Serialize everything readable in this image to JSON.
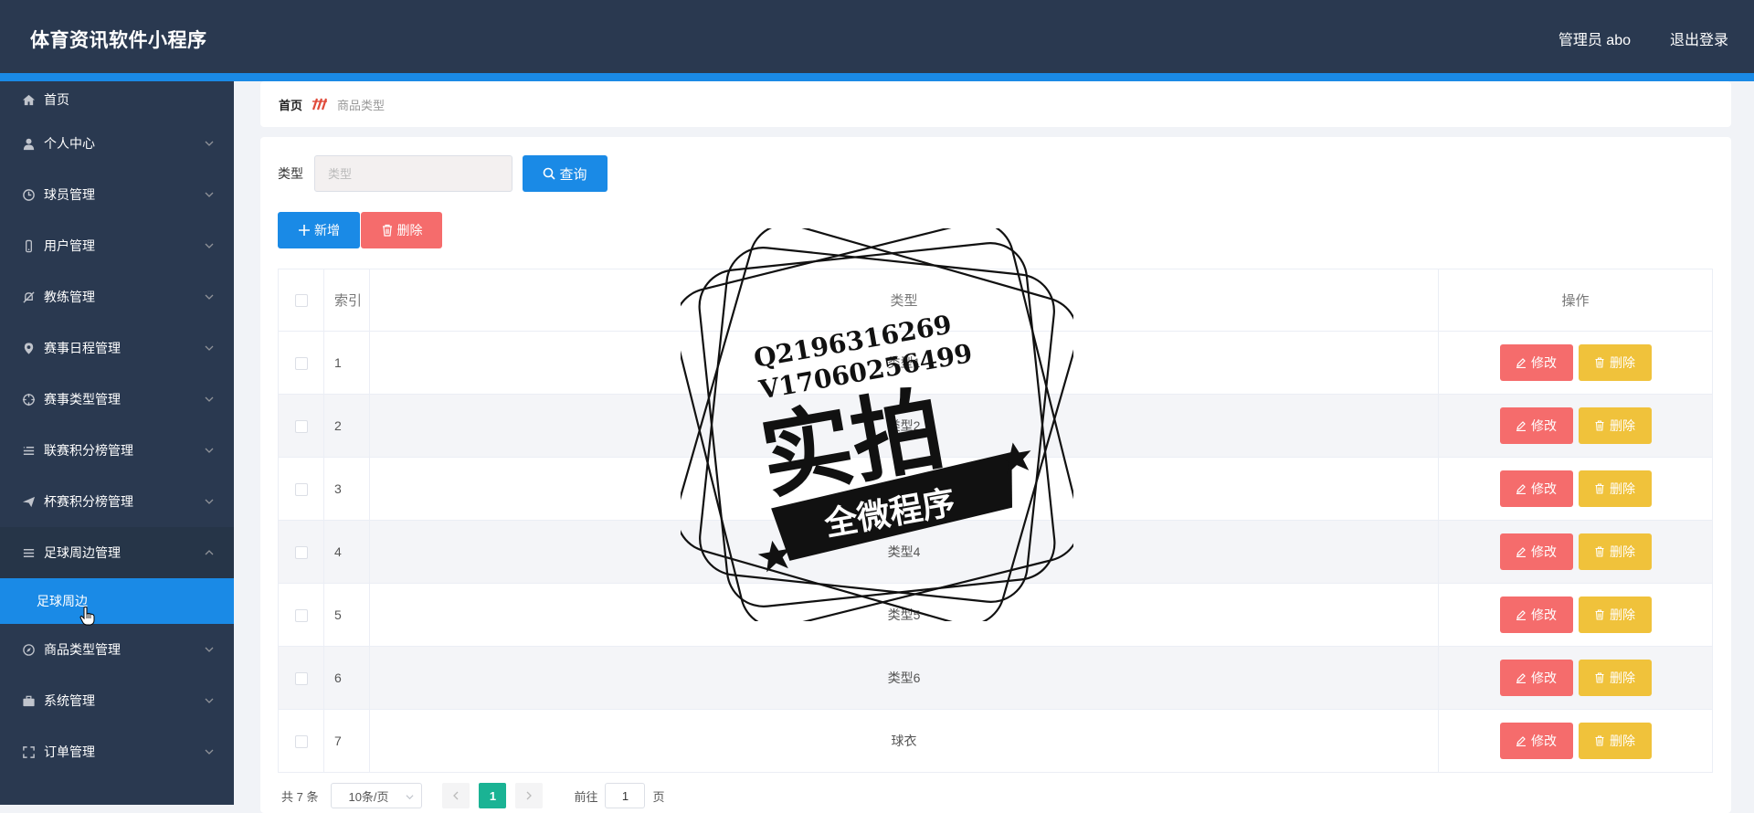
{
  "header": {
    "title": "体育资讯软件小程序",
    "admin_label": "管理员 abo",
    "logout": "退出登录"
  },
  "sidebar": {
    "items": [
      {
        "label": "首页",
        "icon": "home-icon"
      },
      {
        "label": "个人中心",
        "icon": "user-icon"
      },
      {
        "label": "球员管理",
        "icon": "clock-icon"
      },
      {
        "label": "用户管理",
        "icon": "phone-icon"
      },
      {
        "label": "教练管理",
        "icon": "bell-off-icon"
      },
      {
        "label": "赛事日程管理",
        "icon": "location-icon"
      },
      {
        "label": "赛事类型管理",
        "icon": "aim-icon"
      },
      {
        "label": "联赛积分榜管理",
        "icon": "list-icon"
      },
      {
        "label": "杯赛积分榜管理",
        "icon": "send-icon"
      },
      {
        "label": "足球周边管理",
        "icon": "menu-icon"
      },
      {
        "label": "商品类型管理",
        "icon": "compass-icon"
      },
      {
        "label": "系统管理",
        "icon": "briefcase-icon"
      },
      {
        "label": "订单管理",
        "icon": "fullscreen-icon"
      }
    ],
    "sub_item": "足球周边"
  },
  "breadcrumb": {
    "home": "首页",
    "current": "商品类型"
  },
  "search": {
    "label": "类型",
    "placeholder": "类型",
    "button": "查询"
  },
  "actions": {
    "add": "新增",
    "delete": "删除"
  },
  "table": {
    "headers": {
      "index": "索引",
      "type": "类型",
      "ops": "操作"
    },
    "rows": [
      {
        "index": "1",
        "type": "类型1"
      },
      {
        "index": "2",
        "type": "类型2"
      },
      {
        "index": "3",
        "type": "类型3"
      },
      {
        "index": "4",
        "type": "类型4"
      },
      {
        "index": "5",
        "type": "类型5"
      },
      {
        "index": "6",
        "type": "类型6"
      },
      {
        "index": "7",
        "type": "球衣"
      }
    ],
    "edit_label": "修改",
    "delete_label": "删除"
  },
  "pagination": {
    "total": "共 7 条",
    "page_size": "10条/页",
    "current_page": "1",
    "goto_prefix": "前往",
    "goto_value": "1",
    "goto_suffix": "页"
  },
  "watermark": {
    "line1": "Q2196316269",
    "line2": "V17060256499",
    "main": "实拍",
    "ribbon": "全微程序"
  },
  "colors": {
    "header_bg": "#2a3950",
    "accent_blue": "#1a8ae6",
    "danger": "#f56c6c",
    "warning": "#f0c23b",
    "page_active": "#1ab394"
  }
}
